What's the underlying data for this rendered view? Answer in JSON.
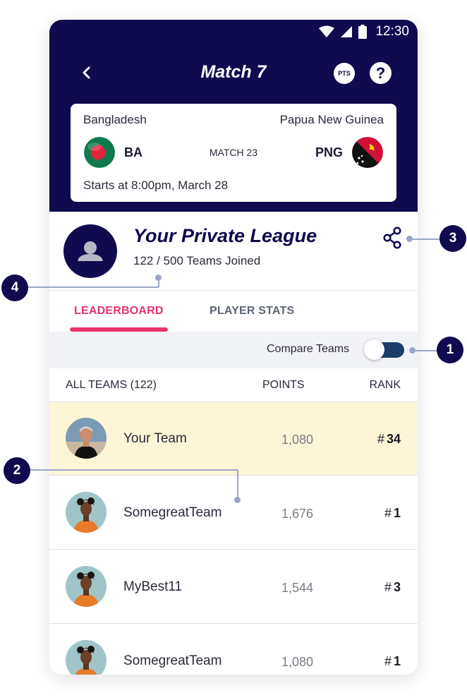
{
  "status_bar": {
    "time": "12:30"
  },
  "app_bar": {
    "title": "Match 7",
    "pts_label": "PTS",
    "help_label": "?"
  },
  "match": {
    "team_left": {
      "name": "Bangladesh",
      "code": "BA"
    },
    "team_right": {
      "name": "Papua New Guinea",
      "code": "PNG"
    },
    "match_label": "MATCH 23",
    "start": "Starts at 8:00pm, March 28"
  },
  "league": {
    "title": "Your Private League",
    "teams_joined": "122 / 500 Teams Joined"
  },
  "tabs": [
    {
      "label": "LEADERBOARD",
      "active": true
    },
    {
      "label": "PLAYER STATS",
      "active": false
    }
  ],
  "compare": {
    "label": "Compare Teams",
    "enabled": true
  },
  "table": {
    "headers": {
      "teams": "ALL TEAMS (122)",
      "points": "POINTS",
      "rank": "RANK"
    },
    "rows": [
      {
        "name": "Your Team",
        "points": "1,080",
        "rank_prefix": "#",
        "rank": "34",
        "highlight": true
      },
      {
        "name": "SomegreatTeam",
        "points": "1,676",
        "rank_prefix": "#",
        "rank": "1",
        "highlight": false
      },
      {
        "name": "MyBest11",
        "points": "1,544",
        "rank_prefix": "#",
        "rank": "3",
        "highlight": false
      },
      {
        "name": "SomegreatTeam",
        "points": "1,080",
        "rank_prefix": "#",
        "rank": "1",
        "highlight": false
      }
    ]
  },
  "callouts": [
    "1",
    "2",
    "3",
    "4"
  ],
  "colors": {
    "navy": "#100a4f",
    "accent_pink": "#e8336b",
    "highlight_row": "#fcf6d7",
    "toggle_track": "#1b3d6a"
  }
}
